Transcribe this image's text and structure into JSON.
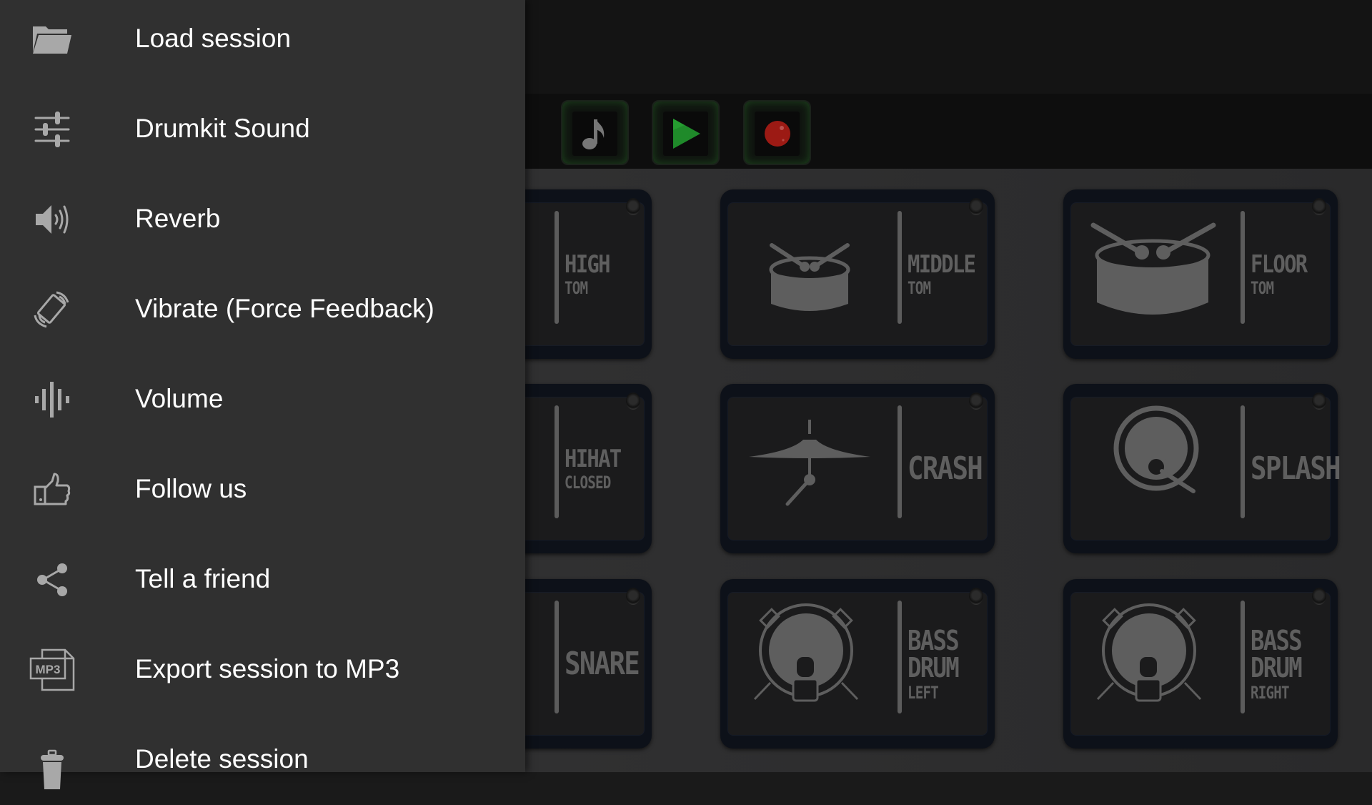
{
  "drawer": {
    "items": [
      {
        "label": "Load session",
        "icon": "folder-icon"
      },
      {
        "label": "Drumkit Sound",
        "icon": "sliders-icon"
      },
      {
        "label": "Reverb",
        "icon": "speaker-icon"
      },
      {
        "label": "Vibrate (Force Feedback)",
        "icon": "vibrate-icon"
      },
      {
        "label": "Volume",
        "icon": "sound-wave-icon"
      },
      {
        "label": "Follow us",
        "icon": "thumbs-up-icon"
      },
      {
        "label": "Tell a friend",
        "icon": "share-icon"
      },
      {
        "label": "Export session to MP3",
        "icon": "mp3-file-icon"
      },
      {
        "label": "Delete session",
        "icon": "trash-icon"
      }
    ],
    "mp3_badge": "MP3"
  },
  "toolbar": {
    "buttons": [
      {
        "name": "music-note",
        "icon": "music-note-icon"
      },
      {
        "name": "play",
        "icon": "play-icon"
      },
      {
        "name": "record",
        "icon": "record-icon"
      }
    ]
  },
  "pads": [
    {
      "line1": "HIGH",
      "line2": "TOM"
    },
    {
      "line1": "MIDDLE",
      "line2": "TOM"
    },
    {
      "line1": "FLOOR",
      "line2": "TOM"
    },
    {
      "line1": "HIHAT",
      "line2": "CLOSED"
    },
    {
      "line1": "CRASH",
      "line2": ""
    },
    {
      "line1": "SPLASH",
      "line2": ""
    },
    {
      "line1": "SNARE",
      "line2": ""
    },
    {
      "line1": "BASS",
      "line2": "DRUM",
      "line3": "LEFT"
    },
    {
      "line1": "BASS",
      "line2": "DRUM",
      "line3": "RIGHT"
    }
  ],
  "colors": {
    "drawer_bg": "#303030",
    "menu_text": "#ffffff",
    "icon_gray": "#a8a8a8",
    "play_green": "#1f8a2a",
    "record_red": "#9c1a14"
  }
}
